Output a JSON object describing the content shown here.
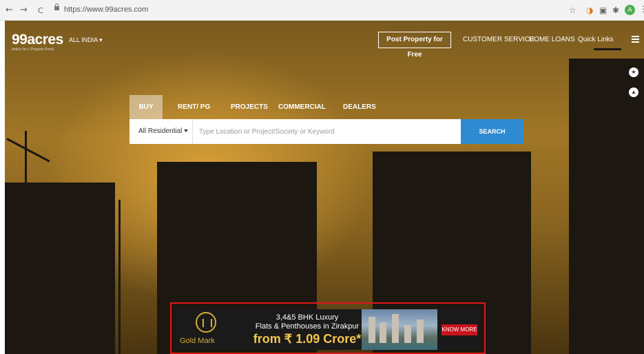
{
  "browser": {
    "back": "←",
    "forward": "→",
    "reload": "C",
    "url": "https://www.99acres.com",
    "avatar_initial": "A"
  },
  "site": {
    "logo": "99acres",
    "tagline": "India's No.1 Property Portal",
    "region": "ALL INDIA ▾",
    "post_property": "Post Property for Free",
    "nav": [
      "CUSTOMER SERVICE",
      "HOME LOANS",
      "Quick Links"
    ]
  },
  "search": {
    "tabs": [
      "BUY",
      "RENT/ PG",
      "PROJECTS",
      "COMMERCIAL",
      "DEALERS"
    ],
    "active_tab": "BUY",
    "property_type": "All Residential",
    "placeholder": "Type Location or Project/Society or Keyword",
    "button": "SEARCH"
  },
  "ad": {
    "brand": "Gold Mark",
    "line1": "3,4&5 BHK Luxury",
    "line2": "Flats & Penthouses in Zirakpur",
    "price": "from ₹ 1.09 Crore*",
    "cta": "KNOW MORE"
  },
  "colors": {
    "search_button": "#2e8bd1",
    "ad_highlight": "#e01818",
    "brand_gold": "#d4af37"
  }
}
